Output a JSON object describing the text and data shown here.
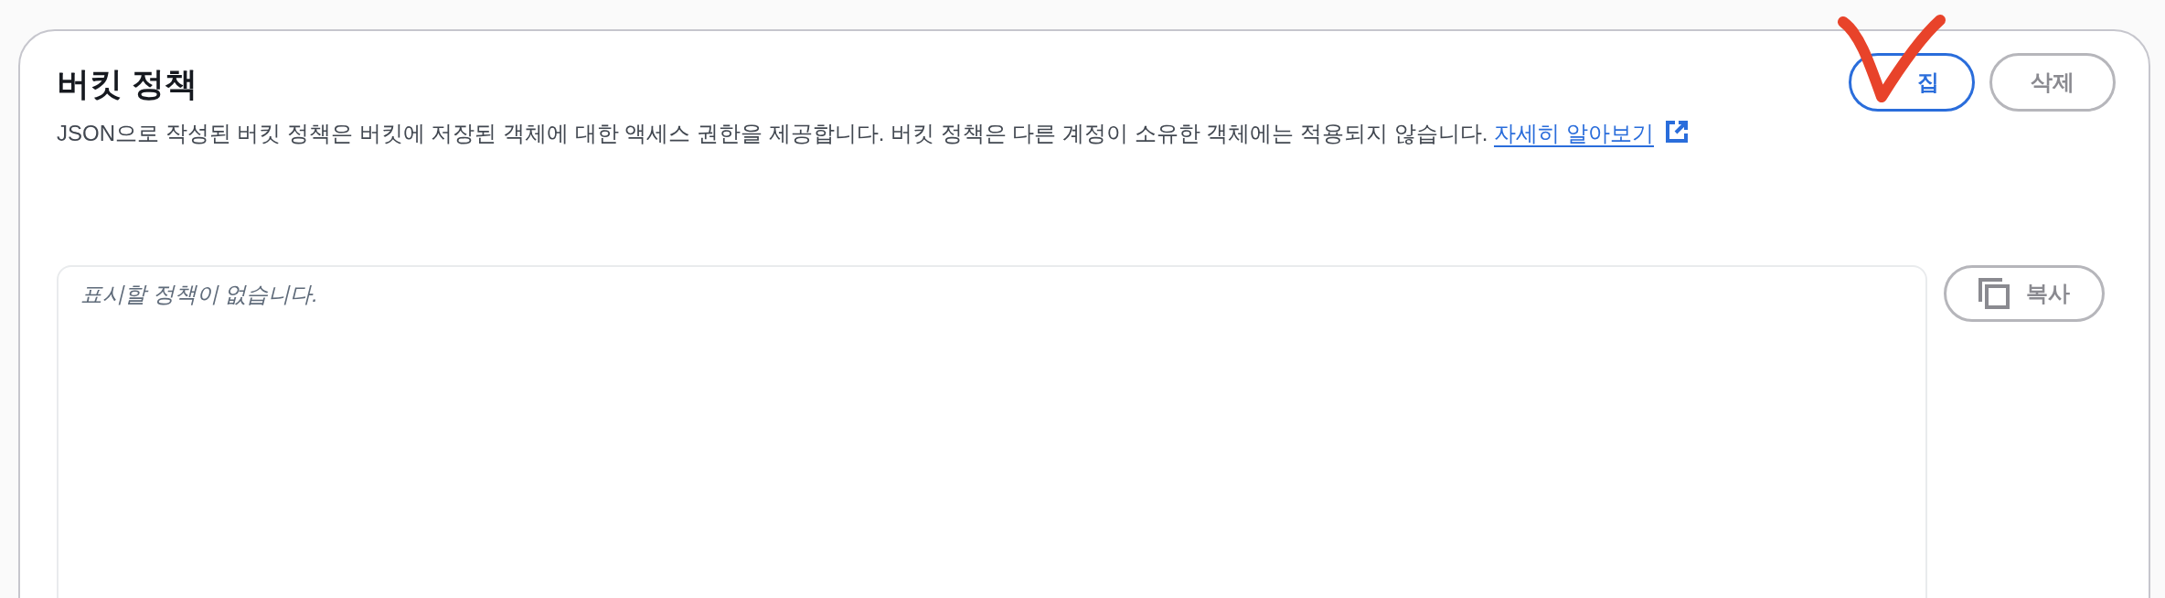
{
  "panel": {
    "title": "버킷 정책",
    "description": "JSON으로 작성된 버킷 정책은 버킷에 저장된 객체에 대한 액세스 권한을 제공합니다. 버킷 정책은 다른 계정이 소유한 객체에는 적용되지 않습니다.",
    "learn_more_link": "자세히 알아보기",
    "buttons": [
      {
        "label": "집",
        "kind": "primary"
      },
      {
        "label": "삭제",
        "kind": "normal"
      }
    ],
    "policy_editor": {
      "placeholder": "표시할 정책이 없습니다."
    },
    "copy_button": {
      "label": "복사"
    }
  },
  "annotation": {
    "kind": "checkmark"
  }
}
